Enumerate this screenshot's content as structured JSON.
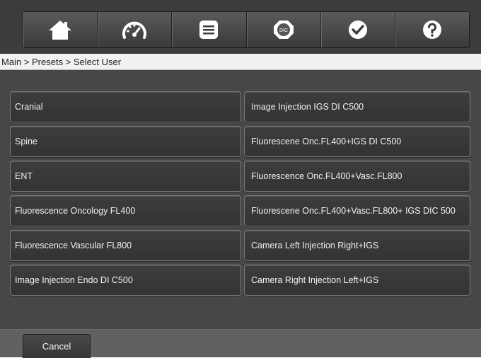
{
  "toolbar": {
    "items": [
      {
        "icon": "home-icon"
      },
      {
        "icon": "speedometer-icon"
      },
      {
        "icon": "list-icon"
      },
      {
        "icon": "dic-icon",
        "label": "DIC"
      },
      {
        "icon": "checkmark-icon"
      },
      {
        "icon": "help-icon"
      }
    ]
  },
  "breadcrumb": "Main > Presets > Select User",
  "presets": {
    "left": [
      "Cranial",
      "Spine",
      "ENT",
      "Fluorescence Oncology FL400",
      "Fluorescence Vascular FL800",
      "Image Injection Endo DI C500"
    ],
    "right": [
      "Image Injection IGS DI C500",
      "Fluorescene Onc.FL400+IGS DI C500",
      "Fluorescence Onc.FL400+Vasc.FL800",
      "Fluorescene Onc.FL400+Vasc.FL800+ IGS DIC 500",
      "Camera Left Injection Right+IGS",
      "Camera Right Injection Left+IGS"
    ]
  },
  "footer": {
    "cancel_label": "Cancel"
  },
  "colors": {
    "background": "#474747",
    "button": "#383838",
    "button_border": "#7a7a7a",
    "breadcrumb_bg": "#f1f1f1"
  }
}
